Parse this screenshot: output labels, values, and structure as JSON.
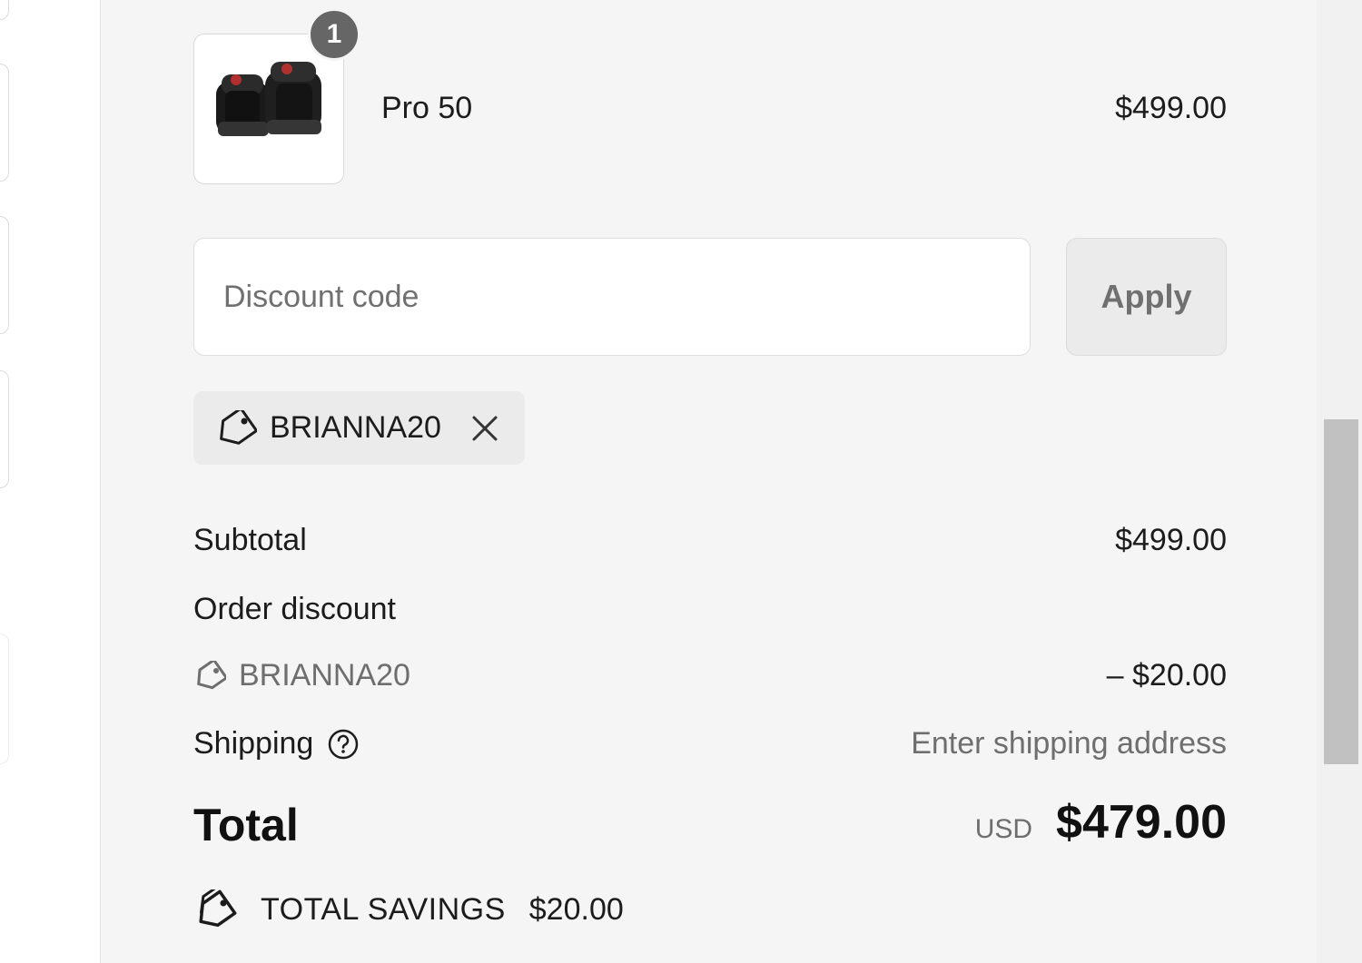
{
  "product": {
    "name": "Pro 50",
    "price": "$499.00",
    "quantity": "1",
    "image_icon": "adjustable-dumbbell-image"
  },
  "discount": {
    "placeholder": "Discount code",
    "apply_label": "Apply",
    "applied_code": "BRIANNA20"
  },
  "summary": {
    "subtotal_label": "Subtotal",
    "subtotal_value": "$499.00",
    "order_discount_label": "Order discount",
    "order_discount_code": "BRIANNA20",
    "order_discount_value": "– $20.00",
    "shipping_label": "Shipping",
    "shipping_value": "Enter shipping address",
    "total_label": "Total",
    "currency": "USD",
    "total_value": "$479.00",
    "savings_label": "TOTAL SAVINGS",
    "savings_value": "$20.00"
  },
  "colors": {
    "summary_bg": "#f5f5f5",
    "badge_bg": "#666666",
    "chip_bg": "#ebebeb",
    "muted_text": "#6e6e6e"
  }
}
